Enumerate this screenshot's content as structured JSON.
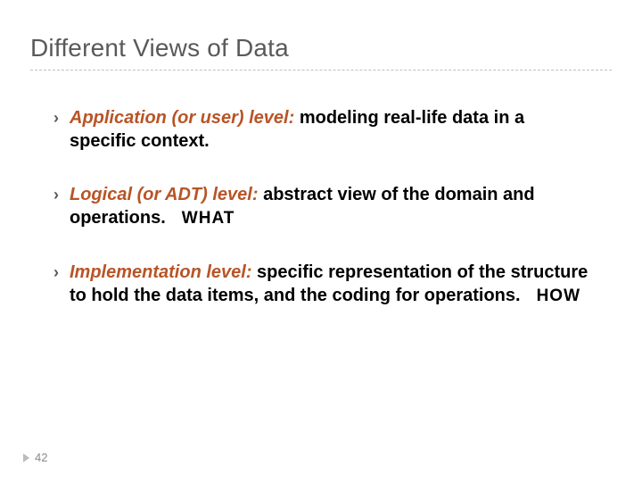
{
  "title": "Different Views of Data",
  "bullets": [
    {
      "emph": "Application (or user) level:",
      "rest": " modeling real-life data in a specific context.",
      "tag": ""
    },
    {
      "emph": "Logical (or ADT) level:",
      "rest": " abstract view of the domain and operations.",
      "tag": "WHAT"
    },
    {
      "emph": "Implementation level:",
      "rest": " specific representation of the structure to hold the data items, and the coding for operations.",
      "tag": "HOW"
    }
  ],
  "page_number": "42"
}
